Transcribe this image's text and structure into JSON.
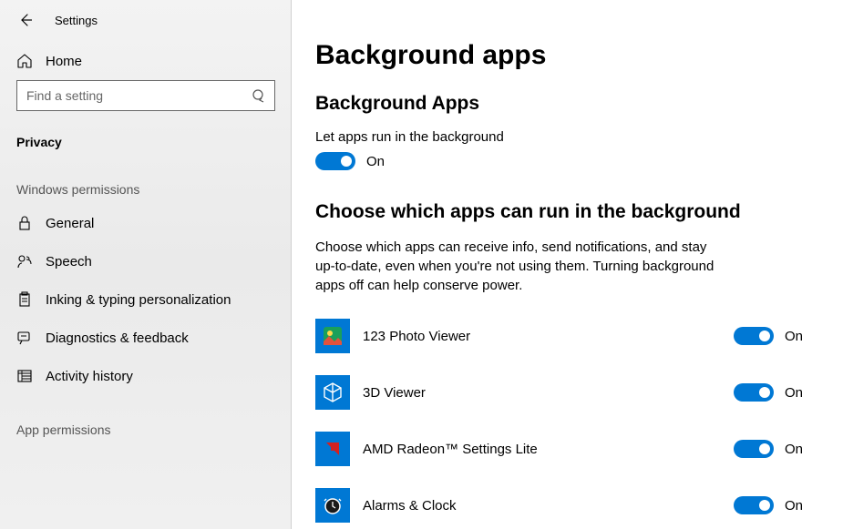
{
  "titlebar": {
    "title": "Settings"
  },
  "home": {
    "label": "Home"
  },
  "search": {
    "placeholder": "Find a setting"
  },
  "section": "Privacy",
  "groups": {
    "windows": {
      "header": "Windows permissions",
      "items": [
        "General",
        "Speech",
        "Inking & typing personalization",
        "Diagnostics & feedback",
        "Activity history"
      ]
    },
    "app": {
      "header": "App permissions"
    }
  },
  "main": {
    "title": "Background apps",
    "master": {
      "heading": "Background Apps",
      "desc": "Let apps run in the background",
      "state": "On"
    },
    "choose": {
      "heading": "Choose which apps can run in the background",
      "info": "Choose which apps can receive info, send notifications, and stay up-to-date, even when you're not using them. Turning background apps off can help conserve power."
    },
    "apps": [
      {
        "name": "123 Photo Viewer",
        "state": "On"
      },
      {
        "name": "3D Viewer",
        "state": "On"
      },
      {
        "name": "AMD Radeon™ Settings Lite",
        "state": "On"
      },
      {
        "name": "Alarms & Clock",
        "state": "On"
      }
    ]
  }
}
